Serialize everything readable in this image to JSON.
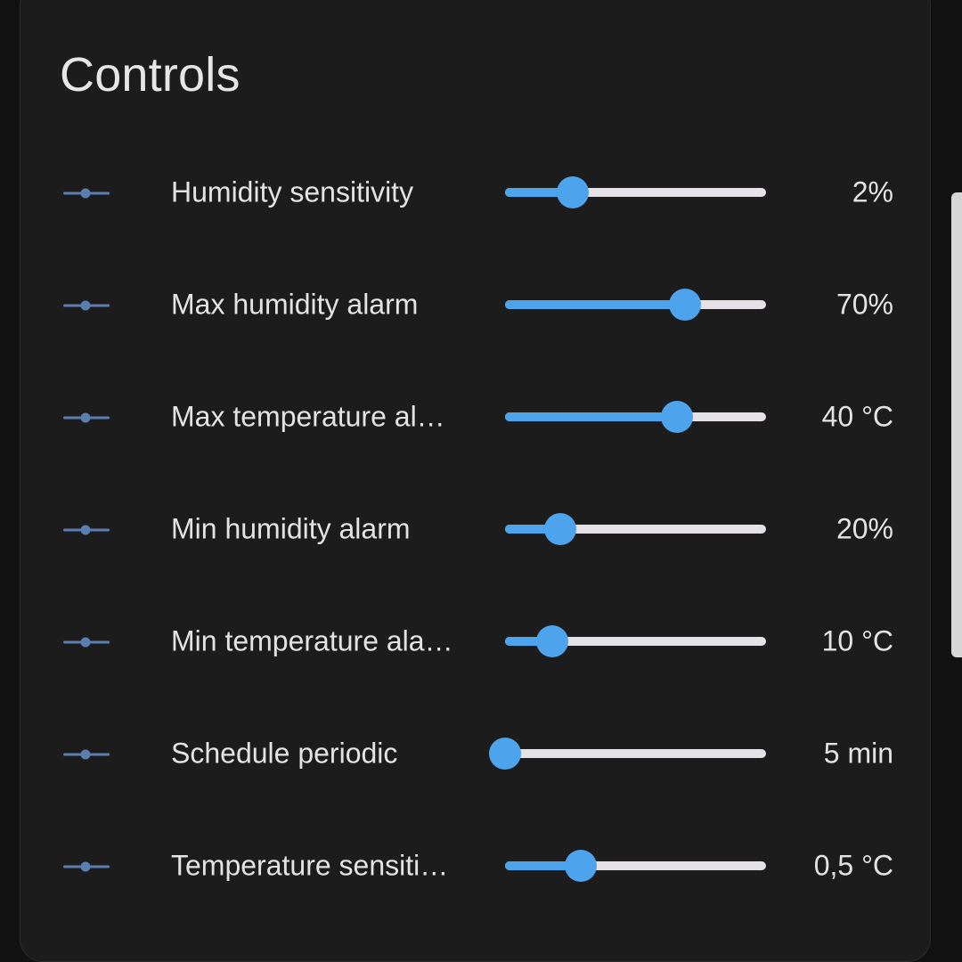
{
  "card": {
    "title": "Controls"
  },
  "colors": {
    "page_background": "#111111",
    "card_background": "#1c1c1c",
    "accent": "#4da3ec",
    "track": "#e4e2e6",
    "icon": "#5a7fb0",
    "text": "#e3e3e3"
  },
  "controls": [
    {
      "icon": "slider-icon",
      "label": "Humidity sensitivity",
      "value_text": "2%",
      "fraction": 0.26
    },
    {
      "icon": "slider-icon",
      "label": "Max humidity alarm",
      "value_text": "70%",
      "fraction": 0.69
    },
    {
      "icon": "slider-icon",
      "label": "Max temperature al…",
      "value_text": "40 °C",
      "fraction": 0.66
    },
    {
      "icon": "slider-icon",
      "label": "Min humidity alarm",
      "value_text": "20%",
      "fraction": 0.21
    },
    {
      "icon": "slider-icon",
      "label": "Min temperature ala…",
      "value_text": "10 °C",
      "fraction": 0.18
    },
    {
      "icon": "slider-icon",
      "label": "Schedule periodic",
      "value_text": "5 min",
      "fraction": 0.0
    },
    {
      "icon": "slider-icon",
      "label": "Temperature sensiti…",
      "value_text": "0,5 °C",
      "fraction": 0.29
    }
  ]
}
